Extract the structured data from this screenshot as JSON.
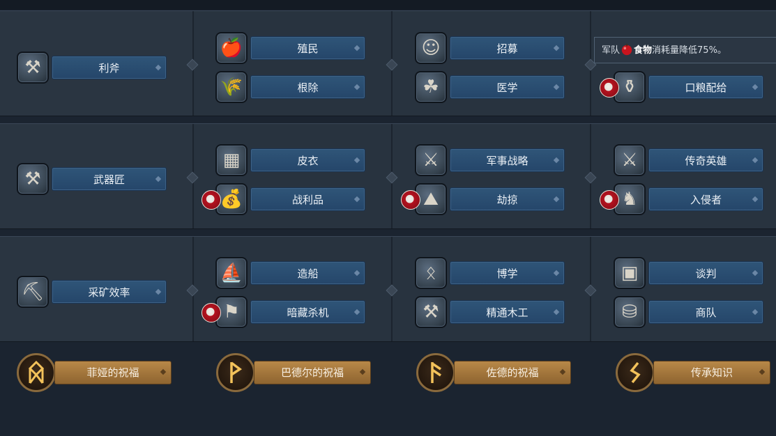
{
  "tooltip": {
    "prefix": "军队",
    "highlight": "食物",
    "suffix": "消耗量降低75%。"
  },
  "rows": [
    {
      "main": {
        "label": "利斧",
        "icon": "hammer-axe-icon"
      },
      "col2": [
        {
          "label": "殖民",
          "icon": "food-basket-icon"
        },
        {
          "label": "根除",
          "icon": "grain-sack-icon"
        }
      ],
      "col3": [
        {
          "label": "招募",
          "icon": "warrior-portrait-icon"
        },
        {
          "label": "医学",
          "icon": "herb-leaf-icon"
        }
      ],
      "col4": [
        {
          "label": "口粮配给",
          "icon": "ration-bag-icon"
        }
      ]
    },
    {
      "main": {
        "label": "武器匠",
        "icon": "anvil-icon"
      },
      "col2": [
        {
          "label": "皮衣",
          "icon": "leather-hide-icon"
        },
        {
          "label": "战利品",
          "icon": "loot-bag-icon"
        }
      ],
      "col3": [
        {
          "label": "军事战略",
          "icon": "sword-sparkle-icon"
        },
        {
          "label": "劫掠",
          "icon": "plunder-pile-icon"
        }
      ],
      "col4": [
        {
          "label": "传奇英雄",
          "icon": "battle-axe-icon"
        },
        {
          "label": "入侵者",
          "icon": "horned-helmet-icon"
        }
      ]
    },
    {
      "main": {
        "label": "采矿效率",
        "icon": "pickaxe-icon"
      },
      "col2": [
        {
          "label": "造船",
          "icon": "longship-icon"
        },
        {
          "label": "暗藏杀机",
          "icon": "banner-icon"
        }
      ],
      "col3": [
        {
          "label": "博学",
          "icon": "rune-stone-icon"
        },
        {
          "label": "精通木工",
          "icon": "carpentry-hammer-icon"
        }
      ],
      "col4": [
        {
          "label": "谈判",
          "icon": "trade-crates-icon"
        },
        {
          "label": "商队",
          "icon": "coins-scroll-icon"
        }
      ]
    }
  ],
  "blessings": [
    {
      "label": "菲娅的祝福",
      "icon": "rune-othala-icon"
    },
    {
      "label": "巴德尔的祝福",
      "icon": "rune-wunjo-icon"
    },
    {
      "label": "佐德的祝福",
      "icon": "rune-ansuz-icon"
    },
    {
      "label": "传承知识",
      "icon": "rune-sowilo-icon"
    }
  ],
  "colors": {
    "panel": "#28333f",
    "label_blue": "#2f5578",
    "label_gold": "#b88848",
    "rune_gold": "#f3c25a",
    "badge_red": "#b5121f"
  }
}
